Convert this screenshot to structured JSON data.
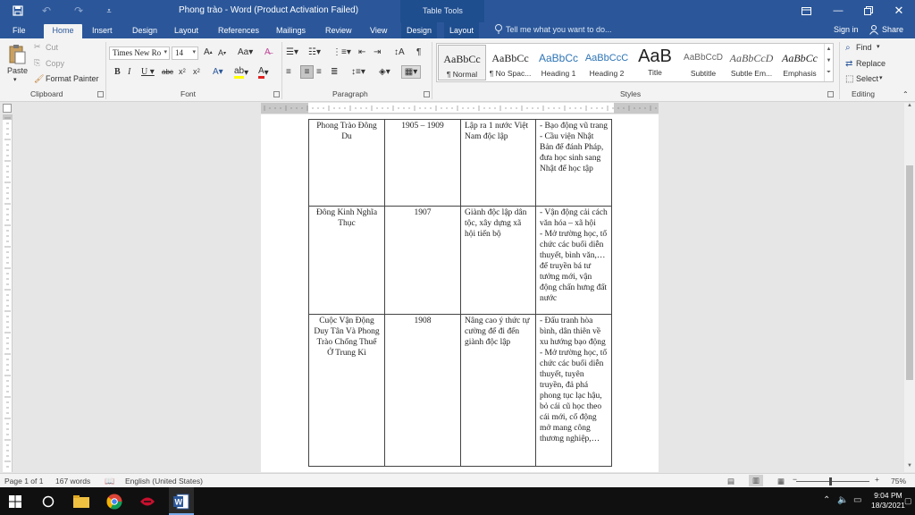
{
  "window": {
    "title": "Phong trào - Word (Product Activation Failed)",
    "contextual_group": "Table Tools"
  },
  "tabs": [
    "File",
    "Home",
    "Insert",
    "Design",
    "Layout",
    "References",
    "Mailings",
    "Review",
    "View",
    "Design",
    "Layout"
  ],
  "tell_me_placeholder": "Tell me what you want to do...",
  "account": {
    "signin": "Sign in",
    "share": "Share"
  },
  "clipboard": {
    "paste": "Paste",
    "cut": "Cut",
    "copy": "Copy",
    "format_painter": "Format Painter",
    "label": "Clipboard"
  },
  "font": {
    "name": "Times New Ro",
    "size": "14",
    "label": "Font"
  },
  "paragraph": {
    "label": "Paragraph"
  },
  "styles": {
    "label": "Styles",
    "items": [
      {
        "preview": "AaBbCс",
        "name": "¶ Normal"
      },
      {
        "preview": "AaBbCс",
        "name": "¶ No Spac..."
      },
      {
        "preview": "AaBbCс",
        "name": "Heading 1"
      },
      {
        "preview": "AaBbCсC",
        "name": "Heading 2"
      },
      {
        "preview": "AaB",
        "name": "Title"
      },
      {
        "preview": "AaBbCсD",
        "name": "Subtitle"
      },
      {
        "preview": "AaBbCсD",
        "name": "Subtle Em..."
      },
      {
        "preview": "AaBbCс",
        "name": "Emphasis"
      }
    ]
  },
  "editing": {
    "find": "Find",
    "replace": "Replace",
    "select": "Select",
    "label": "Editing"
  },
  "table_rows": [
    {
      "name": "Phong Trào Đông Du",
      "years": "1905 – 1909",
      "goal": "Lập ra 1 nước Việt Nam độc lập",
      "method": [
        "- Bạo động vũ trang",
        "- Cầu viện Nhật Bản để đánh Pháp, đưa học sinh sang Nhật để học tập"
      ]
    },
    {
      "name": "Đông Kinh Nghĩa Thục",
      "years": "1907",
      "goal": "Giành độc lập dân tộc, xây dựng xã hội tiến bộ",
      "method": [
        "- Vận động cải cách văn hóa – xã hội",
        "- Mở trường học, tổ chức các buổi diễn thuyết, bình văn,… để truyền bá tư tưởng mới, vận động chấn hưng đất nước"
      ]
    },
    {
      "name": "Cuộc Vận Động Duy Tân Và Phong Trào Chống Thuế Ở Trung Kì",
      "years": "1908",
      "goal": "Nâng cao ý thức tự cường để đi đến giành độc lập",
      "method": [
        "- Đấu tranh hòa bình, dân thiên về xu hướng bạo động",
        "- Mở trường học, tổ chức các buổi diễn thuyết, tuyên truyền, đả phá phong tục lạc hậu, bỏ cái cũ học theo cái mới, cổ động mở mang công thương nghiệp,…"
      ]
    }
  ],
  "status": {
    "page": "Page 1 of 1",
    "words": "167 words",
    "language": "English (United States)",
    "zoom": "75%"
  },
  "clock": {
    "time": "9:04 PM",
    "date": "18/3/2021"
  }
}
